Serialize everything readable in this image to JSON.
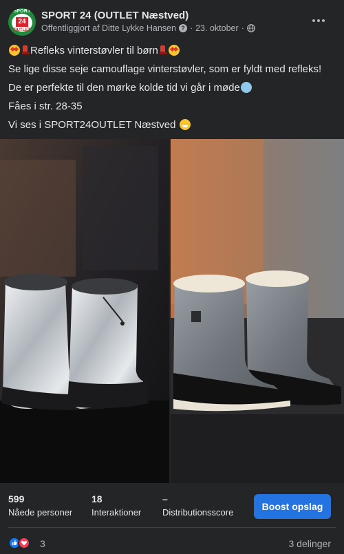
{
  "post": {
    "page_name": "SPORT 24 (OUTLET Næstved)",
    "published_by": "Offentliggjort af Ditte Lykke Hansen",
    "separator": "·",
    "date": "23. oktober",
    "avatar": {
      "top_text": "SPORT",
      "number": "24",
      "bottom_text": "OUTLET"
    },
    "text_lines": [
      "Refleks vinterstøvler til børn",
      "Se lige disse seje camouflage vinterstøvler, som er fyldt med refleks!",
      "De er perfekte til den mørke kolde tid vi går i møde",
      "Fåes i str. 28-35",
      "Vi ses i SPORT24OUTLET Næstved"
    ]
  },
  "insights": {
    "reach": {
      "value": "599",
      "label": "Nåede personer"
    },
    "interactions": {
      "value": "18",
      "label": "Interaktioner"
    },
    "distribution": {
      "value": "–",
      "label": "Distributionsscore"
    },
    "boost_label": "Boost opslag"
  },
  "footer": {
    "reaction_count": "3",
    "shares": "3 delinger"
  },
  "colors": {
    "background": "#242526",
    "boost_button": "#2374e1",
    "like": "#1877f2",
    "love": "#f33e58"
  },
  "icons": [
    "avatar-logo",
    "question-icon",
    "globe-icon",
    "more-icon",
    "like-icon",
    "love-icon"
  ]
}
